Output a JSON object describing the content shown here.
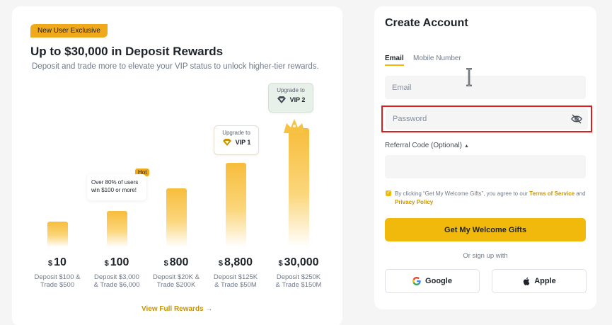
{
  "promo": {
    "badge": "New User Exclusive",
    "title": "Up to $30,000 in Deposit Rewards",
    "subtitle": "Deposit and trade more to elevate your VIP status to unlock higher-tier rewards.",
    "hot_tag": "Hot",
    "hot_note": "Over 80% of users win $100 or more!",
    "upgrade_label": "Upgrade to",
    "vip1": "VIP 1",
    "vip2": "VIP 2",
    "view_full": "View Full Rewards →",
    "tiers": [
      {
        "currency": "$",
        "amount": "10",
        "req1": "Deposit $100 &",
        "req2": "Trade $500",
        "level": 0.12
      },
      {
        "currency": "$",
        "amount": "100",
        "req1": "Deposit $3,000",
        "req2": "& Trade $6,000",
        "level": 0.22
      },
      {
        "currency": "$",
        "amount": "800",
        "req1": "Deposit $20K &",
        "req2": "Trade $200K",
        "level": 0.43
      },
      {
        "currency": "$",
        "amount": "8,800",
        "req1": "Deposit $125K",
        "req2": "& Trade $50M",
        "level": 0.67
      },
      {
        "currency": "$",
        "amount": "30,000",
        "req1": "Deposit $250K",
        "req2": "& Trade $150M",
        "level": 1.0
      }
    ]
  },
  "form": {
    "title": "Create Account",
    "tab_email": "Email",
    "tab_mobile": "Mobile Number",
    "email_placeholder": "Email",
    "password_placeholder": "Password",
    "referral_label": "Referral Code (Optional)",
    "terms_prefix": "By clicking “Get My Welcome Gifts”, you agree to our",
    "terms_link": "Terms of Service",
    "terms_and": "and",
    "privacy_link": "Privacy Policy",
    "submit": "Get My Welcome Gifts",
    "or_text": "Or sign up with",
    "google": "Google",
    "apple": "Apple"
  },
  "colors": {
    "accent": "#f0b90b",
    "error": "#e01b1b",
    "link": "#c99400"
  },
  "icons": [
    "eye-off-icon",
    "google-icon",
    "apple-icon",
    "diamond-icon",
    "text-cursor-icon",
    "crown-icon"
  ]
}
